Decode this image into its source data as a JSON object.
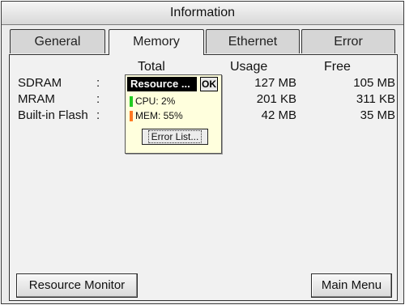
{
  "window": {
    "title": "Information"
  },
  "tabs": [
    {
      "label": "General",
      "active": false
    },
    {
      "label": "Memory",
      "active": true
    },
    {
      "label": "Ethernet",
      "active": false
    },
    {
      "label": "Error",
      "active": false
    }
  ],
  "memory": {
    "headers": {
      "total": "Total",
      "usage": "Usage",
      "free": "Free"
    },
    "rows": [
      {
        "name": "SDRAM",
        "sep": ":",
        "usage": "127 MB",
        "free": "105 MB"
      },
      {
        "name": "MRAM",
        "sep": ":",
        "usage": "201 KB",
        "free": "311 KB"
      },
      {
        "name": "Built-in Flash",
        "sep": ":",
        "usage": "42 MB",
        "free": "35 MB"
      }
    ]
  },
  "resource_popup": {
    "title": "Resource ...",
    "ok_label": "OK",
    "cpu_text": "CPU:  2%",
    "mem_text": "MEM: 55%",
    "cpu_color": "#22cc22",
    "mem_color": "#ff7a22",
    "error_list_label": "Error List..."
  },
  "buttons": {
    "resource_monitor": "Resource Monitor",
    "main_menu": "Main Menu"
  }
}
